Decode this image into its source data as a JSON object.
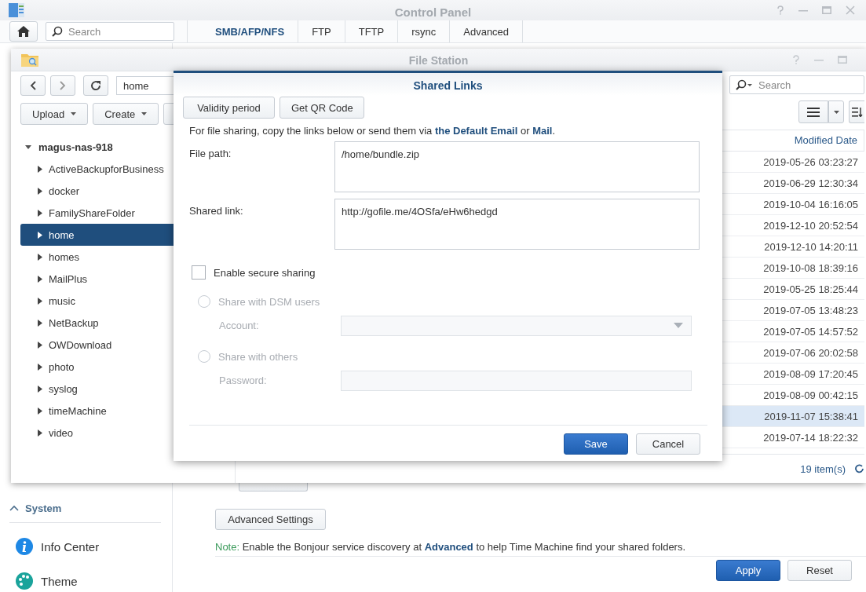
{
  "control_panel": {
    "title": "Control Panel",
    "search": {
      "placeholder": "Search"
    },
    "tabs": [
      {
        "label": "SMB/AFP/NFS",
        "selected": true
      },
      {
        "label": "FTP",
        "selected": false
      },
      {
        "label": "TFTP",
        "selected": false
      },
      {
        "label": "rsync",
        "selected": false
      },
      {
        "label": "Advanced",
        "selected": false
      }
    ],
    "sidebar": {
      "section": "System",
      "expanded": true,
      "items": [
        {
          "label": "Info Center",
          "kind": "info"
        },
        {
          "label": "Theme",
          "kind": "theme"
        }
      ]
    },
    "buttons": [
      "Advanced Settings"
    ],
    "note": [
      {
        "text": "Note:",
        "kind": "label"
      },
      {
        "text": " Enable the Bonjour service discovery at ",
        "kind": "text"
      },
      {
        "text": "Advanced",
        "kind": "link"
      },
      {
        "text": " to help Time Machine find your shared folders.",
        "kind": "text"
      }
    ],
    "actions": [
      {
        "label": "Apply",
        "primary": true
      },
      {
        "label": "Reset",
        "primary": false
      }
    ]
  },
  "file_station": {
    "title": "File Station",
    "path": "home",
    "toolbar": [
      "Upload",
      "Create"
    ],
    "tree": {
      "label": "magus-nas-918",
      "expanded": true,
      "children": [
        {
          "label": "ActiveBackupforBusiness",
          "selected": false
        },
        {
          "label": "docker",
          "selected": false
        },
        {
          "label": "FamilyShareFolder",
          "selected": false
        },
        {
          "label": "home",
          "selected": true
        },
        {
          "label": "homes",
          "selected": false
        },
        {
          "label": "MailPlus",
          "selected": false
        },
        {
          "label": "music",
          "selected": false
        },
        {
          "label": "NetBackup",
          "selected": false
        },
        {
          "label": "OWDownload",
          "selected": false
        },
        {
          "label": "photo",
          "selected": false
        },
        {
          "label": "syslog",
          "selected": false
        },
        {
          "label": "timeMachine",
          "selected": false
        },
        {
          "label": "video",
          "selected": false
        }
      ]
    },
    "search": {
      "placeholder": "Search"
    },
    "columns": [
      "Modified Date"
    ],
    "rows": [
      {
        "modified": "2019-05-26 03:23:27",
        "selected": false
      },
      {
        "modified": "2019-06-29 12:30:34",
        "selected": false
      },
      {
        "modified": "2019-10-04 16:16:05",
        "selected": false
      },
      {
        "modified": "2019-12-10 20:52:54",
        "selected": false
      },
      {
        "modified": "2019-12-10 14:20:11",
        "selected": false
      },
      {
        "modified": "2019-10-08 18:39:16",
        "selected": false
      },
      {
        "modified": "2019-05-25 18:25:44",
        "selected": false
      },
      {
        "modified": "2019-07-05 13:48:23",
        "selected": false
      },
      {
        "modified": "2019-07-05 14:57:52",
        "selected": false
      },
      {
        "modified": "2019-07-06 20:02:58",
        "selected": false
      },
      {
        "modified": "2019-08-09 17:20:45",
        "selected": false
      },
      {
        "modified": "2019-08-09 00:42:15",
        "selected": false
      },
      {
        "modified": "2019-11-07 15:38:41",
        "selected": true
      },
      {
        "modified": "2019-07-14 18:22:32",
        "selected": false
      }
    ],
    "status": "19 item(s)"
  },
  "dialog": {
    "title": "Shared Links",
    "buttons": [
      "Validity period",
      "Get QR Code"
    ],
    "intro": [
      {
        "text": "For file sharing, copy the links below or send them via ",
        "kind": "text"
      },
      {
        "text": "the Default Email",
        "kind": "link"
      },
      {
        "text": " or ",
        "kind": "text"
      },
      {
        "text": "Mail",
        "kind": "link"
      },
      {
        "text": ".",
        "kind": "text"
      }
    ],
    "fields": [
      {
        "label": "File path:",
        "value": "/home/bundle.zip"
      },
      {
        "label": "Shared link:",
        "value": "http://gofile.me/4OSfa/eHw6hedgd"
      }
    ],
    "secure": {
      "label": "Enable secure sharing",
      "checked": false
    },
    "options": [
      {
        "label": "Share with DSM users",
        "selected": false,
        "disabled": true,
        "field": {
          "label": "Account:",
          "kind": "select"
        }
      },
      {
        "label": "Share with others",
        "selected": false,
        "disabled": true,
        "field": {
          "label": "Password:",
          "kind": "text"
        }
      }
    ],
    "actions": [
      {
        "label": "Save",
        "primary": true
      },
      {
        "label": "Cancel",
        "primary": false
      }
    ]
  }
}
